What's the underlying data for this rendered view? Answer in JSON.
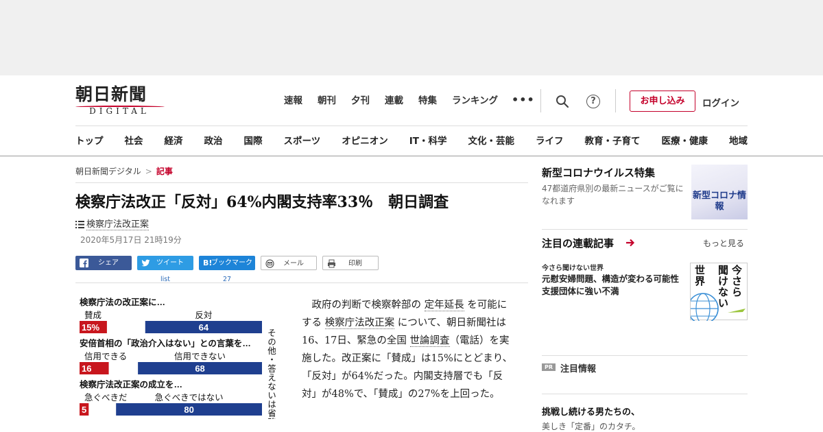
{
  "brand": {
    "logo_jp": "朝日新聞",
    "logo_en": "DIGITAL"
  },
  "topnav": [
    "速報",
    "朝刊",
    "夕刊",
    "連載",
    "特集",
    "ランキング"
  ],
  "header": {
    "more": "•••",
    "subscribe": "お申し込み",
    "login": "ログイン"
  },
  "catnav": [
    "トップ",
    "社会",
    "経済",
    "政治",
    "国際",
    "スポーツ",
    "オピニオン",
    "IT・科学",
    "文化・芸能",
    "ライフ",
    "教育・子育て",
    "医療・健康",
    "地域"
  ],
  "breadcrumb": {
    "home": "朝日新聞デジタル",
    "sep": ">",
    "current": "記事"
  },
  "article": {
    "title": "検察庁法改正「反対」64%内閣支持率33％　朝日調査",
    "tag": "検察庁法改正案",
    "date": "2020年5月17日 21時19分",
    "body": {
      "p1": "　政府の判断で検察幹部の",
      "l1": "定年延長",
      "p2": "を可能にする",
      "l2": "検察庁法改正案",
      "p3": "について、朝日新聞社は16、17日、緊急の全国",
      "l3": "世論調査",
      "p4": "（電話）を実施した。改正案に「賛成」は15%にとどまり、「反対」が64%だった。内閣支持層でも「反対」が48%で、「賛成」の27%を上回った。"
    }
  },
  "share": {
    "facebook": "シェア",
    "twitter": "ツイート",
    "twitter_count": "list",
    "hatena": "ブックマーク",
    "hatena_count": "27",
    "mail": "メール",
    "print": "印刷"
  },
  "chart_data": {
    "type": "bar",
    "title": "",
    "side_note": "その他・答えないは省略",
    "questions": [
      {
        "q": "検察庁法の改正案に…",
        "left_label": "賛成",
        "right_label": "反対",
        "left_value": 15,
        "right_value": 64
      },
      {
        "q": "安倍首相の「政治介入はない」との言葉を…",
        "left_label": "信用できる",
        "right_label": "信用できない",
        "left_value": 16,
        "right_value": 68
      },
      {
        "q": "検察庁法改正案の成立を…",
        "left_label": "急ぐべきだ",
        "right_label": "急ぐべきではない",
        "left_value": 5,
        "right_value": 80
      }
    ],
    "colors": {
      "left": "#c8161d",
      "right": "#1f3f8f"
    }
  },
  "sidebar": {
    "corona": {
      "title": "新型コロナウイルス特集",
      "desc": "47都道府県別の最新ニュースがご覧になれます",
      "thumb_caption": "新型コロナ情報"
    },
    "series": {
      "title": "注目の連載記事",
      "more": "もっと見る",
      "label": "今さら聞けない世界",
      "headline": "元慰安婦問題、構造が変わる可能性　支援団体に強い不満",
      "thumb": {
        "a": "今さら",
        "b": "聞けない",
        "c": "世界"
      }
    },
    "pr": {
      "badge": "PR",
      "label": "注目情報"
    },
    "promo": {
      "headline": "挑戦し続ける男たちの、",
      "sub": "美しき「定番」のカタチ。"
    }
  }
}
